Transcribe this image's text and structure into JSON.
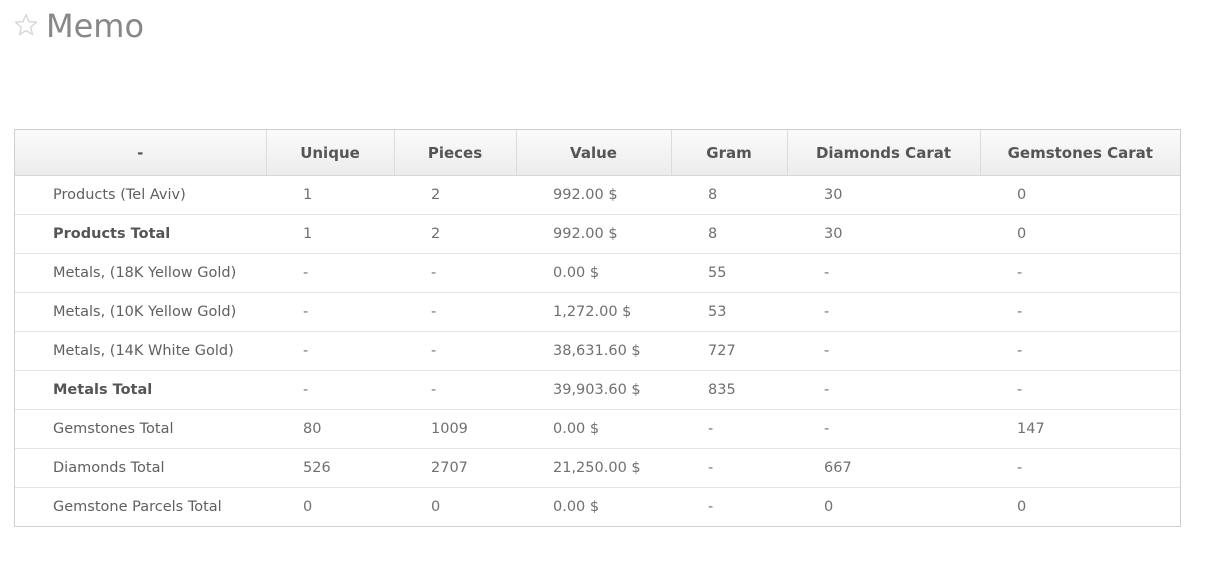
{
  "page": {
    "title": "Memo"
  },
  "table": {
    "headers": [
      "-",
      "Unique",
      "Pieces",
      "Value",
      "Gram",
      "Diamonds Carat",
      "Gemstones Carat"
    ],
    "rows": [
      {
        "bold": false,
        "cells": [
          "Products (Tel Aviv)",
          "1",
          "2",
          "992.00 $",
          "8",
          "30",
          "0"
        ]
      },
      {
        "bold": true,
        "cells": [
          "Products Total",
          "1",
          "2",
          "992.00 $",
          "8",
          "30",
          "0"
        ]
      },
      {
        "bold": false,
        "cells": [
          "Metals, (18K Yellow Gold)",
          "-",
          "-",
          "0.00 $",
          "55",
          "-",
          "-"
        ]
      },
      {
        "bold": false,
        "cells": [
          "Metals, (10K Yellow Gold)",
          "-",
          "-",
          "1,272.00 $",
          "53",
          "-",
          "-"
        ]
      },
      {
        "bold": false,
        "cells": [
          "Metals, (14K White Gold)",
          "-",
          "-",
          "38,631.60 $",
          "727",
          "-",
          "-"
        ]
      },
      {
        "bold": true,
        "cells": [
          "Metals Total",
          "-",
          "-",
          "39,903.60 $",
          "835",
          "-",
          "-"
        ]
      },
      {
        "bold": false,
        "cells": [
          "Gemstones Total",
          "80",
          "1009",
          "0.00 $",
          "-",
          "-",
          "147"
        ]
      },
      {
        "bold": false,
        "cells": [
          "Diamonds Total",
          "526",
          "2707",
          "21,250.00 $",
          "-",
          "667",
          "-"
        ]
      },
      {
        "bold": false,
        "cells": [
          "Gemstone Parcels Total",
          "0",
          "0",
          "0.00 $",
          "-",
          "0",
          "0"
        ]
      }
    ]
  },
  "icons": {
    "favorite": "star-outline-icon"
  },
  "colors": {
    "title": "#888888",
    "header_bg": "#efefef",
    "border": "#cfcfcf",
    "text": "#707070"
  }
}
